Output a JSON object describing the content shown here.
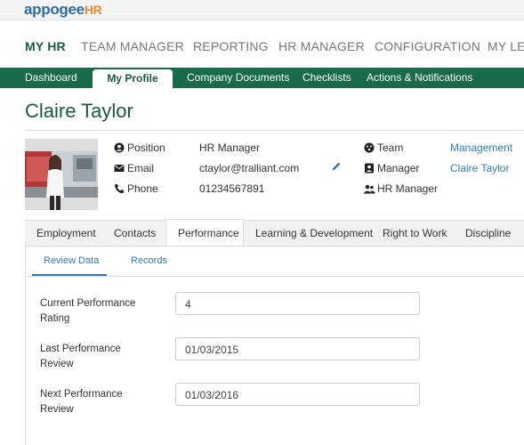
{
  "brand": {
    "name_a": "appogee",
    "name_b": "HR"
  },
  "topnav": [
    "MY HR",
    "TEAM MANAGER",
    "REPORTING",
    "HR MANAGER",
    "CONFIGURATION",
    "MY LEA"
  ],
  "subnav": {
    "dashboard": "Dashboard",
    "my_profile": "My Profile",
    "company_documents": "Company Documents",
    "checklists": "Checklists",
    "actions": "Actions & Notifications"
  },
  "profile": {
    "name": "Claire Taylor",
    "position_label": "Position",
    "position_value": "HR Manager",
    "email_label": "Email",
    "email_value": "ctaylor@tralliant.com",
    "phone_label": "Phone",
    "phone_value": "01234567891",
    "team_label": "Team",
    "team_value": "Management",
    "manager_label": "Manager",
    "manager_value": "Claire Taylor",
    "role_value": "HR Manager"
  },
  "tabs": [
    "Employment",
    "Contacts",
    "Performance",
    "Learning & Development",
    "Right to Work",
    "Discipline"
  ],
  "subtabs": {
    "review_data": "Review Data",
    "records": "Records"
  },
  "form": {
    "current_rating_label": "Current Performance Rating",
    "current_rating_value": "4",
    "last_review_label": "Last Performance Review",
    "last_review_value": "01/03/2015",
    "next_review_label": "Next Performance Review",
    "next_review_value": "01/03/2016"
  },
  "colors": {
    "brand_green": "#1a6b4a",
    "link_blue": "#2e7ab8",
    "logo_orange": "#e8892b"
  }
}
